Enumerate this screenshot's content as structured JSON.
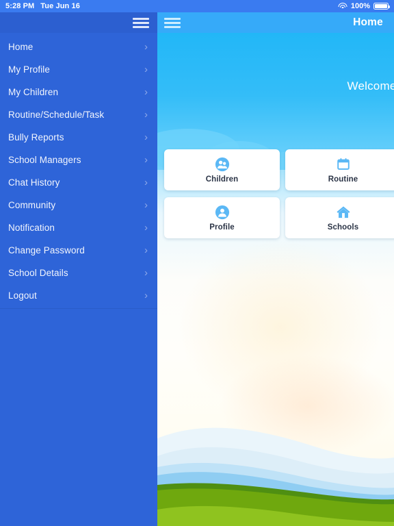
{
  "statusbar": {
    "time": "5:28 PM",
    "date": "Tue Jun 16",
    "battery_percent": "100%",
    "wifi_icon": "wifi-icon",
    "battery_icon": "battery-icon"
  },
  "sidebar": {
    "menu_icon": "hamburger-menu-icon",
    "chevron": "›",
    "items": [
      {
        "label": "Home"
      },
      {
        "label": "My Profile"
      },
      {
        "label": "My Children"
      },
      {
        "label": "Routine/Schedule/Task"
      },
      {
        "label": "Bully Reports"
      },
      {
        "label": "School Managers"
      },
      {
        "label": "Chat History"
      },
      {
        "label": "Community"
      },
      {
        "label": "Notification"
      },
      {
        "label": "Change Password"
      },
      {
        "label": "School Details"
      },
      {
        "label": "Logout"
      }
    ]
  },
  "header": {
    "menu_icon": "hamburger-menu-icon",
    "title": "Home"
  },
  "main": {
    "welcome_text": "Welcome to Oci",
    "cards": [
      {
        "label": "Children",
        "icon": "two-people-icon"
      },
      {
        "label": "Routine",
        "icon": "calendar-icon"
      },
      {
        "label": "Profile",
        "icon": "person-icon"
      },
      {
        "label": "Schools",
        "icon": "house-icon"
      }
    ]
  },
  "colors": {
    "status_bar": "#3a7bf0",
    "sidebar": "#2e64d8",
    "header": "#36aaf9",
    "sky_top": "#22b7f7",
    "icon_blue": "#5bb8f5",
    "hill_green": "#6fa80e",
    "hill_green_light": "#8fc31f"
  }
}
